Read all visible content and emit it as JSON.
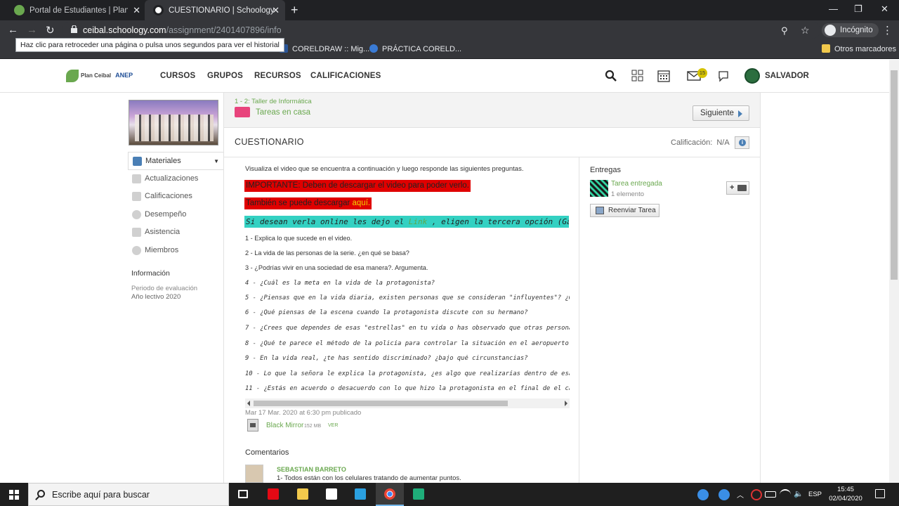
{
  "browser": {
    "tabs": [
      {
        "title": "Portal de Estudiantes | Plan Ceibal",
        "active": false
      },
      {
        "title": "CUESTIONARIO | Schoology",
        "active": true
      }
    ],
    "url_host": "ceibal.schoology.com",
    "url_path": "/assignment/2401407896/info",
    "profile_label": "Incógnito",
    "back_tooltip": "Haz clic para retroceder una página o pulsa unos segundos para ver el historial",
    "bookmarks": [
      {
        "label": "CORELDRAW :: Mig..."
      },
      {
        "label": "PRÁCTICA CORELD..."
      }
    ],
    "other_bookmarks": "Otros marcadores"
  },
  "header": {
    "logo_text": "Plan Ceibal",
    "logo_anep": "ANEP",
    "nav": [
      "CURSOS",
      "GRUPOS",
      "RECURSOS",
      "CALIFICACIONES"
    ],
    "messages_badge": "15",
    "user_name": "SALVADOR"
  },
  "sidebar": {
    "menu": [
      {
        "label": "Materiales",
        "active": true
      },
      {
        "label": "Actualizaciones"
      },
      {
        "label": "Calificaciones"
      },
      {
        "label": "Desempeño"
      },
      {
        "label": "Asistencia"
      },
      {
        "label": "Miembros"
      }
    ],
    "info_heading": "Información",
    "info_period_label": "Periodo de evaluación",
    "info_period_value": "Año lectivo 2020"
  },
  "breadcrumb": {
    "course": "1 - 2: Taller de Informática",
    "folder": "Tareas en casa",
    "next_button": "Siguiente"
  },
  "assignment": {
    "title": "CUESTIONARIO",
    "grade_label": "Calificación:",
    "grade_value": "N/A",
    "intro": "Visualiza el video que se encuentra a continuación y luego responde las siguientes preguntas.",
    "important": "IMPORTANTE: Deben de descargar el video para poder verlo.",
    "download_prefix": "También se puede descargar ",
    "download_link": "aquí.",
    "online_prefix": "Si desean verla online les dejo el ",
    "online_link": "Link",
    "online_suffix": " , eligen la tercera opción (Ga",
    "questions": [
      " 1 - Explica lo que sucede en el video.",
      "2 - La vida de las personas de la serie. ¿en qué se basa?",
      "3 - ¿Podrías vivir en una sociedad de esa manera?. Argumenta.",
      "4 - ¿Cuál es la meta en la vida de la protagonista?",
      "5 - ¿Piensas que en la vida diaria, existen personas que se consideran \"influyentes\"? ¿Quiéne",
      "6 - ¿Qué piensas de la escena cuando la protagonista discute con su hermano?",
      "7 - ¿Crees que dependes de esas \"estrellas\" en tu vida o has observado que otras personas lo ",
      "8 - ¿Qué te parece el método de la policía para controlar la situación en el aeropuerto?",
      "9 - En la vida real, ¿te has sentido discriminado? ¿bajo qué circunstancias?",
      "10 - Lo que la señora le explica la protagonista, ¿es algo que realizarías dentro de esa soci",
      "11 - ¿Estás en acuerdo o desacuerdo con lo que hizo la protagonista en el final de el capítul"
    ],
    "posted": "Mar 17 Mar. 2020 at 6:30 pm publicado",
    "file_name": "Black Mirror",
    "file_size": "152 MB",
    "file_view": "VER",
    "comments_heading": "Comentarios",
    "comment_author": "SEBASTIAN BARRETO",
    "comment_text": "1- Todos están con los celulares tratando de aumentar puntos."
  },
  "submissions": {
    "heading": "Entregas",
    "status": "Tarea entregada",
    "count": "1 elemento",
    "add_label": "+",
    "resubmit_button": "Reenviar Tarea"
  },
  "taskbar": {
    "search_placeholder": "Escribe aquí para buscar",
    "language": "ESP",
    "time": "15:45",
    "date": "02/04/2020"
  },
  "colors": {
    "accent_green": "#6aa84f",
    "highlight_red": "#e00000",
    "highlight_teal": "#33d1c2",
    "folder_pink": "#e8447c"
  }
}
